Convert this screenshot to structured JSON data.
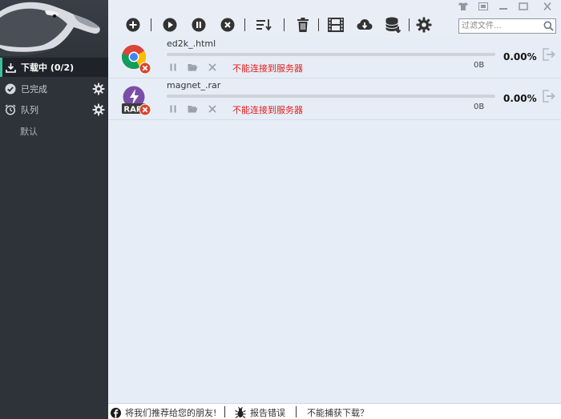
{
  "sidebar": {
    "items": [
      {
        "label": "下载中 (0/2)",
        "icon": "download-icon"
      },
      {
        "label": "已完成",
        "icon": "check-circle-icon"
      },
      {
        "label": "队列",
        "icon": "alarm-clock-icon"
      }
    ],
    "queue_sub": "默认"
  },
  "toolbar": {
    "filter_placeholder": "过滤文件..."
  },
  "downloads": [
    {
      "name": "ed2k_.html",
      "percent": "0.00%",
      "size": "0B",
      "error": "不能连接到服务器",
      "icon": "chrome-html-icon",
      "progress": 0
    },
    {
      "name": "magnet_.rar",
      "percent": "0.00%",
      "size": "0B",
      "error": "不能连接到服务器",
      "icon": "rar-archive-icon",
      "progress": 0
    }
  ],
  "statusbar": {
    "recommend": "将我们推荐给您的朋友!",
    "report": "报告错误",
    "cannot_capture": "不能捕获下载？"
  },
  "colors": {
    "sidebar_bg": "#2e3239",
    "accent": "#3dbfa0",
    "error_red": "#e0201f",
    "list_bg": "#e7edf6"
  }
}
